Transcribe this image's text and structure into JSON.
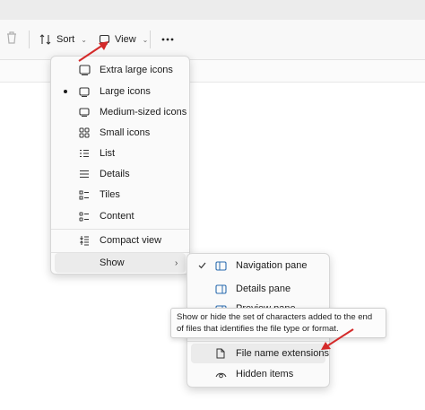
{
  "toolbar": {
    "sort_label": "Sort",
    "view_label": "View"
  },
  "view_menu": {
    "items": [
      {
        "label": "Extra large icons",
        "icon": "extra-large-icons-icon",
        "selected": false
      },
      {
        "label": "Large icons",
        "icon": "large-icons-icon",
        "selected": true
      },
      {
        "label": "Medium-sized icons",
        "icon": "medium-icons-icon",
        "selected": false
      },
      {
        "label": "Small icons",
        "icon": "small-icons-icon",
        "selected": false
      },
      {
        "label": "List",
        "icon": "list-icon",
        "selected": false
      },
      {
        "label": "Details",
        "icon": "details-icon",
        "selected": false
      },
      {
        "label": "Tiles",
        "icon": "tiles-icon",
        "selected": false
      },
      {
        "label": "Content",
        "icon": "content-icon",
        "selected": false
      }
    ],
    "compact_view": "Compact view",
    "show": "Show"
  },
  "show_menu": {
    "items": [
      {
        "label": "Navigation pane",
        "icon": "navigation-pane-icon",
        "checked": true
      },
      {
        "label": "Details pane",
        "icon": "details-pane-icon",
        "checked": false
      },
      {
        "label": "Preview pane",
        "icon": "preview-pane-icon",
        "checked": false
      },
      {
        "label": "File name extensions",
        "icon": "file-icon",
        "checked": false
      },
      {
        "label": "Hidden items",
        "icon": "eye-icon",
        "checked": false
      }
    ]
  },
  "tooltip": {
    "text": "Show or hide the set of characters added to the end of files that identifies the file type or format."
  },
  "colors": {
    "accent": "#2b6cb0",
    "arrow": "#d42a2a"
  }
}
